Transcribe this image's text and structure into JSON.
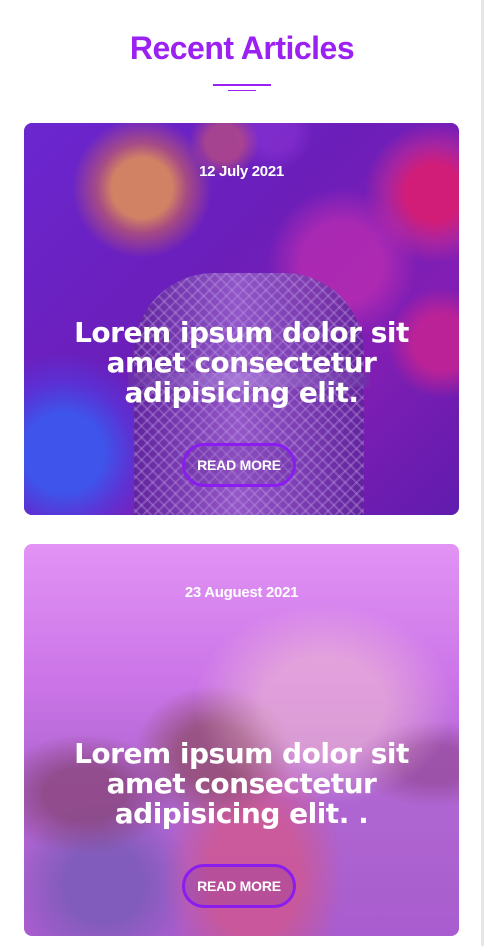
{
  "section": {
    "title": "Recent Articles"
  },
  "articles": [
    {
      "date": "12 July 2021",
      "title": "Lorem ipsum dolor sit amet consectetur adipisicing elit.",
      "button_label": "READ MORE",
      "image": "microphone-photo"
    },
    {
      "date": "23 Auguest 2021",
      "title": "Lorem ipsum dolor sit amet consectetur adipisicing elit. .",
      "button_label": "READ MORE",
      "image": "festival-crowd-photo"
    }
  ],
  "colors": {
    "accent": "#9b21f2",
    "button_border": "#8a1cf0",
    "text_on_image": "#ffffff"
  }
}
